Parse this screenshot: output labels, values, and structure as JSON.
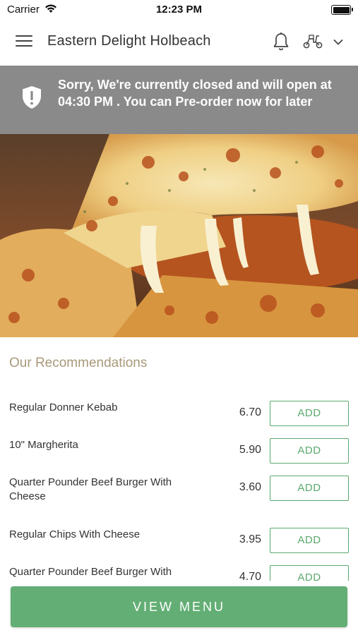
{
  "status_bar": {
    "carrier": "Carrier",
    "time": "12:23 PM"
  },
  "header": {
    "store_name": "Eastern Delight Holbeach",
    "icons": [
      "menu-icon",
      "bell-icon",
      "scooter-icon",
      "chevron-down-icon"
    ]
  },
  "banner": {
    "message": "Sorry, We're currently closed and will open at 04:30 PM . You can Pre-order now for later",
    "icon": "shield-alert-icon"
  },
  "hero": {
    "image": "cheese pizza slice"
  },
  "recommendations": {
    "title": "Our Recommendations",
    "items": [
      {
        "name": "Regular Donner Kebab",
        "price": "6.70",
        "action": "ADD"
      },
      {
        "name": "10\" Margherita",
        "price": "5.90",
        "action": "ADD"
      },
      {
        "name": "Quarter Pounder Beef Burger With Cheese",
        "price": "3.60",
        "action": "ADD"
      },
      {
        "name": "Regular Chips With Cheese",
        "price": "3.95",
        "action": "ADD"
      },
      {
        "name": "Quarter Pounder Beef Burger With",
        "price": "4.70",
        "action": "ADD"
      }
    ]
  },
  "footer": {
    "view_menu_label": "VIEW MENU"
  },
  "colors": {
    "accent_green": "#63ae74",
    "banner_gray": "#8a8a8a",
    "section_title": "#a9997a"
  }
}
